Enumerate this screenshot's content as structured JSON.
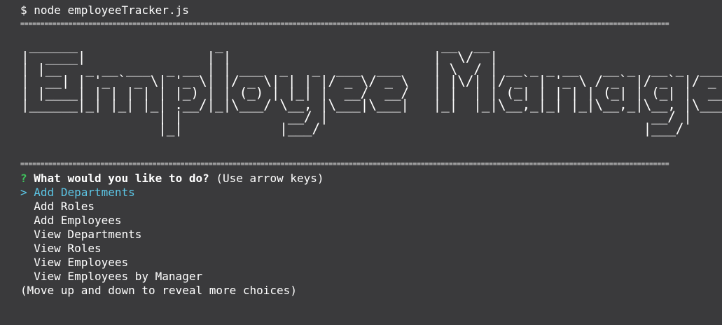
{
  "terminal": {
    "command_prompt": "$",
    "command": "node employeeTracker.js",
    "divider": "==================================================================================================================================================================",
    "banner_text": "EmployeeManager",
    "question": {
      "mark": "?",
      "text": "What would you like to do?",
      "hint": "(Use arrow keys)"
    },
    "pointer": ">",
    "choices": [
      "Add Departments",
      "Add Roles",
      "Add Employees",
      "View Departments",
      "View Roles",
      "View Employees",
      "View Employees by Manager"
    ],
    "footer": "(Move up and down to reveal more choices)"
  },
  "colors": {
    "background": "#3a3a3c",
    "text": "#ffffff",
    "question_mark": "#3fc05c",
    "selected_choice": "#5cc6e6"
  }
}
